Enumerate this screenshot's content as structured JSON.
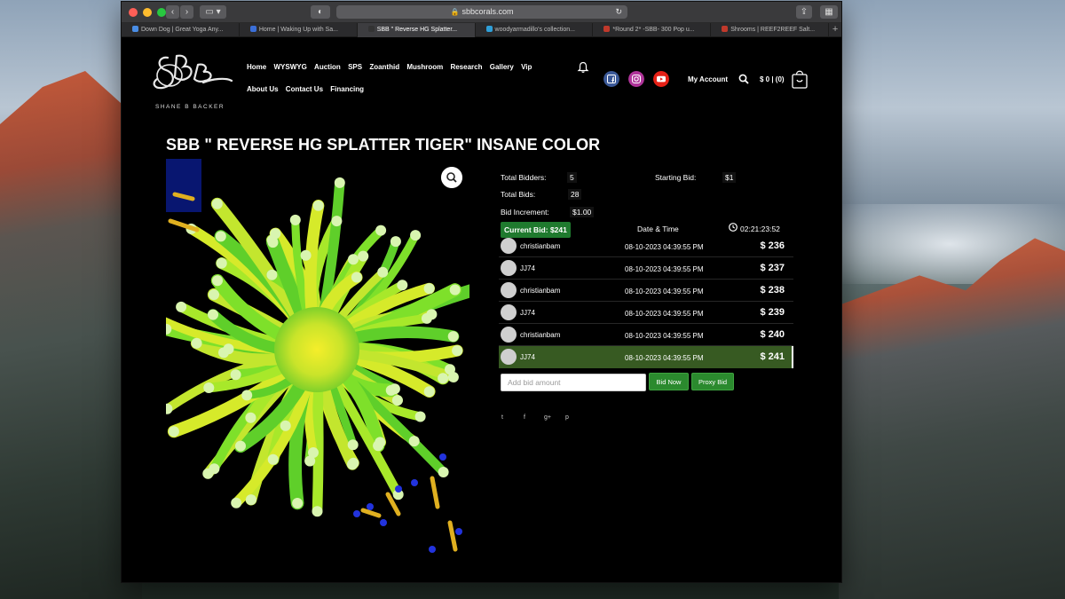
{
  "browser": {
    "url": "sbbcorals.com",
    "tabs": [
      {
        "label": "Down Dog | Great Yoga Any...",
        "fav": "#4a8ee6"
      },
      {
        "label": "Home | Waking Up with Sa...",
        "fav": "#3b6fd8"
      },
      {
        "label": "SBB \" Reverse HG Splatter...",
        "fav": "#333333"
      },
      {
        "label": "woodyarmadillo's collection...",
        "fav": "#2f9fd8"
      },
      {
        "label": "*Round 2* -SBB- 300 Pop u...",
        "fav": "#c0392b"
      },
      {
        "label": "Shrooms | REEF2REEF Salt...",
        "fav": "#c0392b"
      }
    ],
    "plus": "+"
  },
  "site": {
    "logo_sub": "SHANE B BACKER",
    "nav": [
      "Home",
      "WYSWYG",
      "Auction",
      "SPS",
      "Zoanthid",
      "Mushroom",
      "Research",
      "Gallery",
      "Vip",
      "About Us",
      "Contact Us",
      "Financing"
    ],
    "account": "My Account",
    "cart": "$ 0 | (0)"
  },
  "product": {
    "title": "SBB \" REVERSE HG SPLATTER TIGER\" INSANE COLOR",
    "total_bidders_label": "Total Bidders:",
    "total_bidders": "5",
    "starting_bid_label": "Starting Bid:",
    "starting_bid": "$1",
    "total_bids_label": "Total Bids:",
    "total_bids": "28",
    "bid_increment_label": "Bid Increment:",
    "bid_increment": "$1.00",
    "current_bid": "Current Bid: $241",
    "date_time_header": "Date & Time",
    "countdown": "02:21:23:52",
    "bids": [
      {
        "name": "christianbam",
        "datetime": "08-10-2023 04:39:55 PM",
        "amount": "$ 236"
      },
      {
        "name": "JJ74",
        "datetime": "08-10-2023 04:39:55 PM",
        "amount": "$ 237"
      },
      {
        "name": "christianbam",
        "datetime": "08-10-2023 04:39:55 PM",
        "amount": "$ 238"
      },
      {
        "name": "JJ74",
        "datetime": "08-10-2023 04:39:55 PM",
        "amount": "$ 239"
      },
      {
        "name": "christianbam",
        "datetime": "08-10-2023 04:39:55 PM",
        "amount": "$ 240"
      },
      {
        "name": "JJ74",
        "datetime": "08-10-2023 04:39:55 PM",
        "amount": "$ 241"
      }
    ],
    "bid_placeholder": "Add bid amount",
    "bid_now": "Bid Now",
    "proxy_bid": "Proxy Bid",
    "share": [
      "t",
      "f",
      "g+",
      "p"
    ]
  },
  "colors": {
    "accent_green": "#2b8a2e",
    "highlight_row": "#375a22",
    "facebook": "#3b5998",
    "instagram": "#c13584",
    "youtube": "#e62117"
  }
}
